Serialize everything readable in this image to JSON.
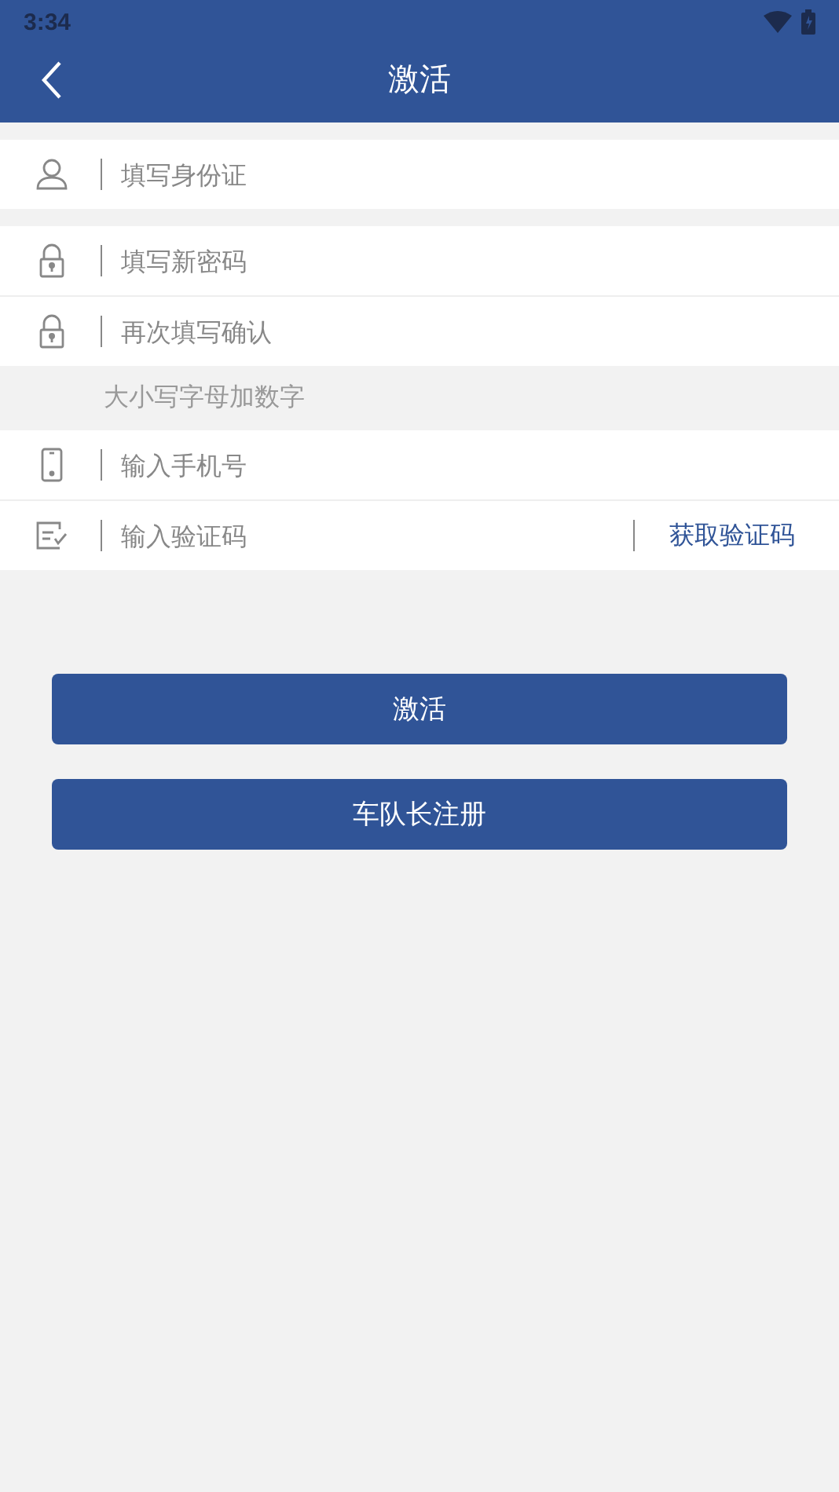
{
  "status_bar": {
    "time": "3:34"
  },
  "header": {
    "title": "激活"
  },
  "groups": [
    {
      "rows": [
        {
          "kind": "id",
          "placeholder": "填写身份证"
        }
      ]
    },
    {
      "rows": [
        {
          "kind": "lock",
          "placeholder": "填写新密码"
        },
        {
          "kind": "lock",
          "placeholder": "再次填写确认"
        }
      ],
      "hint": "大小写字母加数字"
    },
    {
      "rows": [
        {
          "kind": "phone",
          "placeholder": "输入手机号"
        },
        {
          "kind": "code",
          "placeholder": "输入验证码",
          "action": "获取验证码"
        }
      ]
    }
  ],
  "buttons": [
    {
      "label": "激活"
    },
    {
      "label": "车队长注册"
    }
  ]
}
